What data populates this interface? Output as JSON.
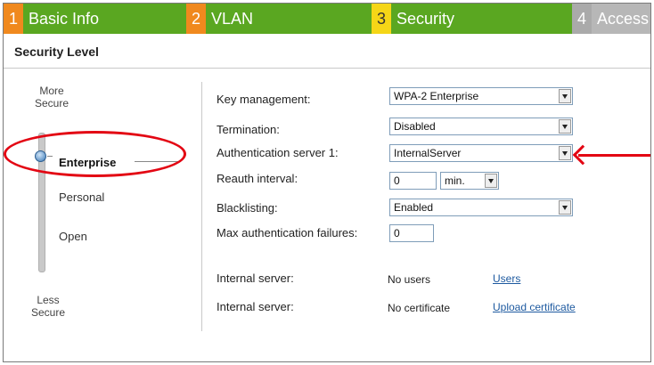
{
  "tabs": [
    {
      "num": "1",
      "label": "Basic Info"
    },
    {
      "num": "2",
      "label": "VLAN"
    },
    {
      "num": "3",
      "label": "Security"
    },
    {
      "num": "4",
      "label": "Access"
    }
  ],
  "section_title": "Security Level",
  "levels": {
    "more": [
      "More",
      "Secure"
    ],
    "less": [
      "Less",
      "Secure"
    ],
    "options": [
      "Enterprise",
      "Personal",
      "Open"
    ],
    "selected": "Enterprise"
  },
  "form": {
    "key_management": {
      "label": "Key management:",
      "value": "WPA-2 Enterprise"
    },
    "termination": {
      "label": "Termination:",
      "value": "Disabled"
    },
    "auth_server_1": {
      "label": "Authentication server 1:",
      "value": "InternalServer"
    },
    "reauth_interval": {
      "label": "Reauth interval:",
      "value": "0",
      "unit": "min."
    },
    "blacklisting": {
      "label": "Blacklisting:",
      "value": "Enabled"
    },
    "max_auth_failures": {
      "label": "Max authentication failures:",
      "value": "0"
    },
    "internal_server_users": {
      "label": "Internal server:",
      "value": "No users",
      "link": "Users"
    },
    "internal_server_cert": {
      "label": "Internal server:",
      "value": "No certificate",
      "link": "Upload certificate"
    }
  },
  "colors": {
    "tab_green": "#5aa721",
    "tab_number_orange": "#f0891e",
    "tab_number_yellow": "#f5d617",
    "tab_inactive_gray": "#b7b7b7",
    "annotation_red": "#e30613",
    "link_blue": "#1e5aa0"
  }
}
